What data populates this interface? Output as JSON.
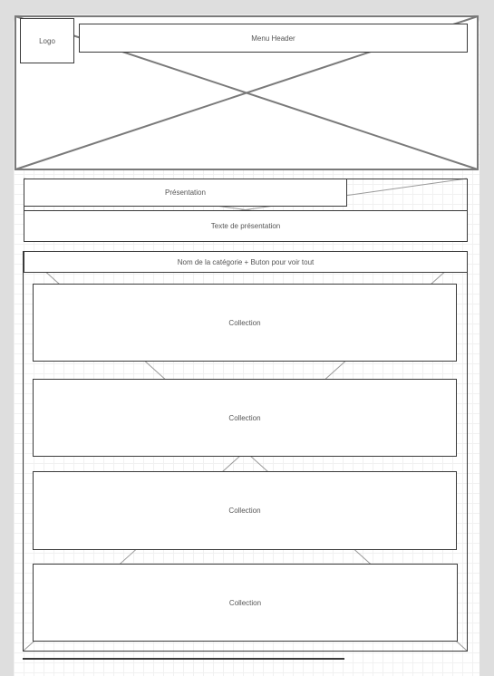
{
  "header": {
    "logo_label": "Logo",
    "menu_label": "Menu Header"
  },
  "presentation": {
    "title": "Présentation",
    "text": "Texte de présentation"
  },
  "category": {
    "title": "Nom de la catégorie + Buton pour voir tout",
    "collections": [
      "Collection",
      "Collection",
      "Collection",
      "Collection"
    ]
  },
  "colors": {
    "frame_background": "#dedede",
    "placeholder_stroke": "#7a7a7a",
    "box_border": "#3a3a3a"
  }
}
